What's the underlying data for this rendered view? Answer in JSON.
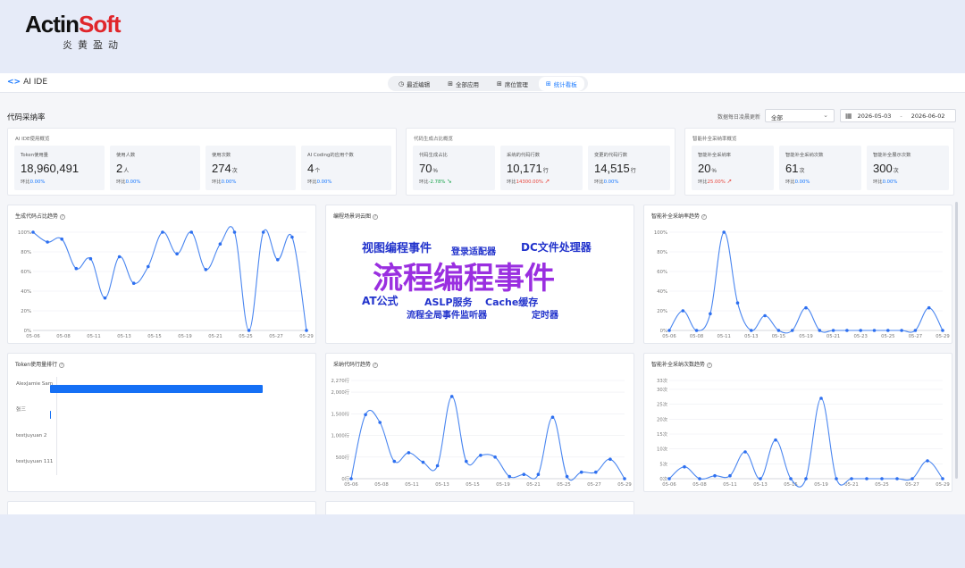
{
  "brand": {
    "name_part1": "Acti",
    "name_part2": "n",
    "name_part3": "Soft",
    "tagline": "炎黄盈动"
  },
  "app": {
    "name": "AI IDE"
  },
  "tabs": [
    {
      "label": "最近编辑",
      "icon": "clock-icon",
      "active": false
    },
    {
      "label": "全部应用",
      "icon": "grid-icon",
      "active": false
    },
    {
      "label": "席位管理",
      "icon": "grid-icon",
      "active": false
    },
    {
      "label": "统计看板",
      "icon": "grid-icon",
      "active": true
    }
  ],
  "page": {
    "title": "代码采纳率",
    "filter_label": "数据每日凌晨更新",
    "select_value": "全部",
    "date_start": "2026-05-03",
    "date_end": "2026-06-02",
    "date_sep": "-"
  },
  "summary": [
    {
      "title": "AI IDE使用概览",
      "stats": [
        {
          "label": "Token使用量",
          "value": "18,960,491",
          "unit": "",
          "cmp_label": "环比",
          "cmp": "0.00%",
          "trend": "flat"
        },
        {
          "label": "使用人数",
          "value": "2",
          "unit": "人",
          "cmp_label": "环比",
          "cmp": "0.00%",
          "trend": "flat"
        },
        {
          "label": "使用次数",
          "value": "274",
          "unit": "次",
          "cmp_label": "环比",
          "cmp": "0.00%",
          "trend": "flat"
        },
        {
          "label": "AI Coding的应用个数",
          "value": "4",
          "unit": "个",
          "cmp_label": "环比",
          "cmp": "0.00%",
          "trend": "flat"
        }
      ]
    },
    {
      "title": "代码生成占比概览",
      "stats": [
        {
          "label": "代码生成占比",
          "value": "70",
          "unit": "%",
          "cmp_label": "环比",
          "cmp": "-2.78%",
          "trend": "down"
        },
        {
          "label": "采纳的代码行数",
          "value": "10,171",
          "unit": "行",
          "cmp_label": "环比",
          "cmp": "14300.00%",
          "trend": "up"
        },
        {
          "label": "变更的代码行数",
          "value": "14,515",
          "unit": "行",
          "cmp_label": "环比",
          "cmp": "0.00%",
          "trend": "flat"
        }
      ]
    },
    {
      "title": "智能补全采纳率概览",
      "stats": [
        {
          "label": "智能补全采纳率",
          "value": "20",
          "unit": "%",
          "cmp_label": "环比",
          "cmp": "25.00%",
          "trend": "up"
        },
        {
          "label": "智能补全采纳次数",
          "value": "61",
          "unit": "次",
          "cmp_label": "环比",
          "cmp": "0.00%",
          "trend": "flat"
        },
        {
          "label": "智能补全展示次数",
          "value": "300",
          "unit": "次",
          "cmp_label": "环比",
          "cmp": "0.00%",
          "trend": "flat"
        }
      ]
    }
  ],
  "panels": {
    "gen_trend_title": "生成代码占比趋势",
    "wordcloud_title": "编程场景词云图",
    "completion_rate_title": "智能补全采纳率趋势",
    "token_rank_title": "Token使用量排行",
    "adopted_lines_title": "采纳代码行趋势",
    "completion_count_title": "智能补全采纳次数趋势"
  },
  "wordcloud": [
    {
      "text": "视图编程事件",
      "color": "#2233cc",
      "size": 13
    },
    {
      "text": "登录适配器",
      "color": "#2233cc",
      "size": 10
    },
    {
      "text": "DC文件处理器",
      "color": "#2233cc",
      "size": 12
    },
    {
      "text": "流程编程事件",
      "color": "#9a2fe0",
      "size": 34
    },
    {
      "text": "AT公式",
      "color": "#2233cc",
      "size": 12
    },
    {
      "text": "ASLP服务",
      "color": "#2233cc",
      "size": 11
    },
    {
      "text": "Cache缓存",
      "color": "#2233cc",
      "size": 11
    },
    {
      "text": "流程全局事件监听器",
      "color": "#2233cc",
      "size": 10
    },
    {
      "text": "定时器",
      "color": "#2233cc",
      "size": 10
    }
  ],
  "token_rank": [
    {
      "name": "AlexJamie Sam",
      "value": 18900000
    },
    {
      "name": "张三",
      "value": 60491
    },
    {
      "name": "testjuyuan 2",
      "value": 0
    },
    {
      "name": "testjuyuan 111",
      "value": 0
    }
  ],
  "chart_data": [
    {
      "type": "line",
      "title": "生成代码占比趋势",
      "x_ticks": [
        "05-06",
        "05-08",
        "05-11",
        "05-13",
        "05-15",
        "05-19",
        "05-21",
        "05-25",
        "05-27",
        "05-29"
      ],
      "y_ticks": [
        "0%",
        "20%",
        "40%",
        "60%",
        "80%",
        "100%"
      ],
      "ylim": [
        0,
        100
      ],
      "values": [
        100,
        90,
        93,
        63,
        73,
        33,
        75,
        48,
        65,
        100,
        78,
        100,
        62,
        88,
        100,
        0,
        100,
        72,
        95,
        0
      ]
    },
    {
      "type": "line",
      "title": "智能补全采纳率趋势",
      "x_ticks": [
        "05-06",
        "05-08",
        "05-11",
        "05-13",
        "05-15",
        "05-19",
        "05-21",
        "05-23",
        "05-25",
        "05-27",
        "05-29"
      ],
      "y_ticks": [
        "0%",
        "20%",
        "40%",
        "60%",
        "80%",
        "100%"
      ],
      "ylim": [
        0,
        100
      ],
      "values": [
        0,
        20,
        0,
        17,
        100,
        28,
        0,
        15,
        0,
        0,
        23,
        0,
        0,
        0,
        0,
        0,
        0,
        0,
        0,
        23,
        0
      ]
    },
    {
      "type": "line",
      "title": "采纳代码行趋势",
      "x_ticks": [
        "05-06",
        "05-08",
        "05-11",
        "05-13",
        "05-15",
        "05-19",
        "05-21",
        "05-25",
        "05-27",
        "05-29"
      ],
      "y_ticks": [
        "0行",
        "500行",
        "1,000行",
        "1,500行",
        "2,000行",
        "2,270行"
      ],
      "y_tick_values": [
        0,
        500,
        1000,
        1500,
        2000,
        2270
      ],
      "ylim": [
        0,
        2270
      ],
      "values": [
        0,
        1480,
        1300,
        400,
        600,
        380,
        300,
        1900,
        400,
        540,
        500,
        50,
        100,
        100,
        1420,
        50,
        150,
        150,
        450,
        0
      ]
    },
    {
      "type": "line",
      "title": "智能补全采纳次数趋势",
      "x_ticks": [
        "05-06",
        "05-08",
        "05-11",
        "05-13",
        "05-15",
        "05-19",
        "05-21",
        "05-25",
        "05-27",
        "05-29"
      ],
      "y_ticks": [
        "0次",
        "5次",
        "10次",
        "15次",
        "20次",
        "25次",
        "30次",
        "33次"
      ],
      "y_tick_values": [
        0,
        5,
        10,
        15,
        20,
        25,
        30,
        33
      ],
      "ylim": [
        0,
        33
      ],
      "values": [
        0,
        4,
        0,
        1,
        1,
        9,
        0,
        13,
        0,
        0,
        27,
        0,
        0,
        0,
        0,
        0,
        0,
        6,
        0
      ]
    }
  ]
}
